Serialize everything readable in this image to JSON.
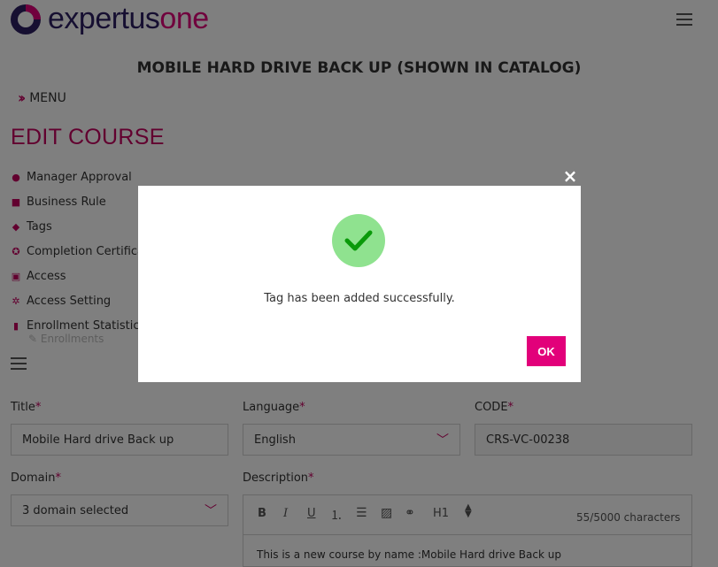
{
  "header": {
    "logo_part1": "expertus",
    "logo_part2": "one",
    "course_title": "MOBILE HARD DRIVE BACK UP (SHOWN IN CATALOG)",
    "menu_label": "MENU"
  },
  "edit": {
    "title": "EDIT COURSE",
    "sidebar": [
      {
        "label": "Manager Approval",
        "icon": "manager-approval-icon"
      },
      {
        "label": "Business Rule",
        "icon": "book-icon"
      },
      {
        "label": "Tags",
        "icon": "tag-icon"
      },
      {
        "label": "Completion Certificate",
        "icon": "certificate-icon"
      },
      {
        "label": "Access",
        "icon": "lock-icon"
      },
      {
        "label": "Access Setting",
        "icon": "users-icon"
      },
      {
        "label": "Enrollment Statistics",
        "icon": "bar-chart-icon"
      }
    ],
    "enrollments_label": "Enrollments"
  },
  "form": {
    "title_label": "Title",
    "title_value": "Mobile Hard drive Back up",
    "language_label": "Language",
    "language_value": "English",
    "code_label": "CODE",
    "code_value": "CRS-VC-00238",
    "domain_label": "Domain",
    "domain_value": "3 domain selected",
    "description_label": "Description",
    "char_count": "55/5000 characters",
    "heading_option": "H1",
    "description_text": "This is a new course by name :Mobile Hard drive Back up",
    "required_mark": "*"
  },
  "modal": {
    "message": "Tag has been added successfully.",
    "ok_label": "OK",
    "close_symbol": "×"
  },
  "colors": {
    "brand_magenta": "#e2007a",
    "brand_navy": "#2c1f63",
    "success_green": "#8fe28f"
  }
}
